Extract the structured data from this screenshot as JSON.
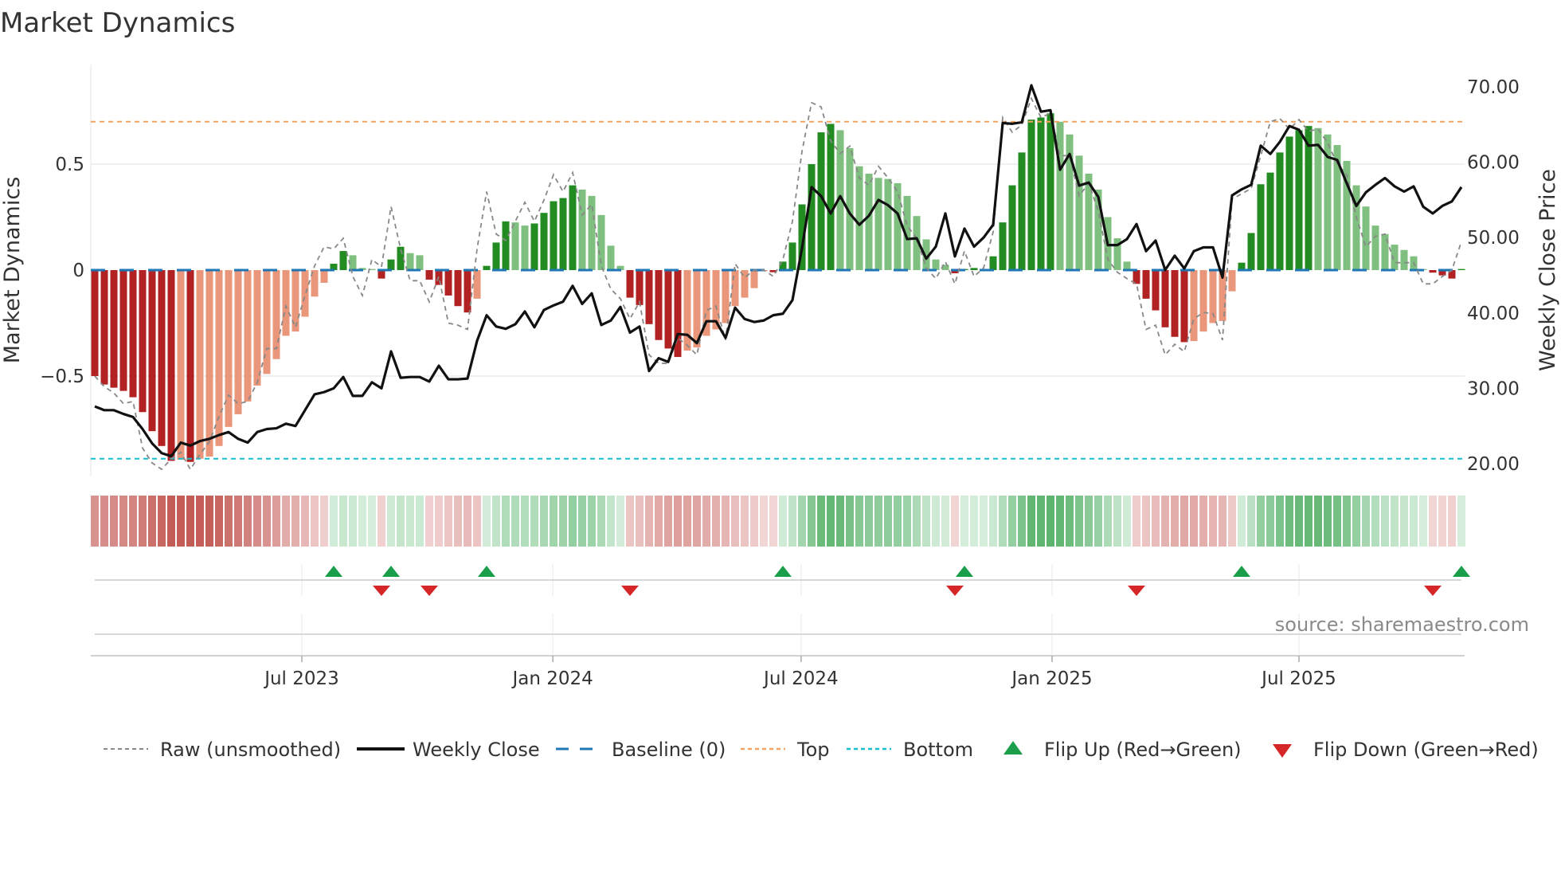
{
  "title": "Market Dynamics",
  "source": "source: sharemaestro.com",
  "legend": {
    "raw": "Raw (unsmoothed)",
    "close": "Weekly Close",
    "baseline": "Baseline (0)",
    "top": "Top",
    "bottom": "Bottom",
    "flip_up": "Flip Up (Red→Green)",
    "flip_down": "Flip Down (Green→Red)"
  },
  "colors": {
    "dark_red": "#b22222",
    "light_red": "#e9967a",
    "dark_green": "#228b22",
    "light_green": "#7fbf7f",
    "baseline": "#1f77b4",
    "top": "#f4a460",
    "bottom": "#17becf",
    "raw": "#888888",
    "close": "#111111",
    "flip_up": "#1a9e4a",
    "flip_down": "#d62728"
  },
  "chart_data": {
    "type": "bar",
    "title": "Market Dynamics",
    "ylabel": "Market Dynamics",
    "y2label": "Weekly Close Price",
    "ylim": [
      -0.91,
      0.91
    ],
    "y2lim": [
      20,
      70
    ],
    "grid": true,
    "legend_position": "bottom",
    "start_week": "2023-01-30",
    "frequency": "weekly",
    "top_level": 0.7,
    "bottom_level": -0.89,
    "baseline": 0,
    "yticks": [
      {
        "value": 0.5,
        "label": "0.5"
      },
      {
        "value": 0,
        "label": "0"
      },
      {
        "value": -0.5,
        "label": "−0.5"
      }
    ],
    "y2ticks": [
      {
        "value": 70,
        "label": "70.00"
      },
      {
        "value": 60,
        "label": "60.00"
      },
      {
        "value": 50,
        "label": "50.00"
      },
      {
        "value": 40,
        "label": "40.00"
      },
      {
        "value": 30,
        "label": "30.00"
      },
      {
        "value": 20,
        "label": "20.00"
      }
    ],
    "xticks": [
      {
        "date": "2023-07-01",
        "label": "Jul 2023"
      },
      {
        "date": "2024-01-01",
        "label": "Jan 2024"
      },
      {
        "date": "2024-07-01",
        "label": "Jul 2024"
      },
      {
        "date": "2025-01-01",
        "label": "Jan 2025"
      },
      {
        "date": "2025-07-01",
        "label": "Jul 2025"
      }
    ],
    "dynamics": [
      -0.5,
      -0.54,
      -0.555,
      -0.57,
      -0.6,
      -0.67,
      -0.76,
      -0.83,
      -0.9,
      -0.895,
      -0.905,
      -0.89,
      -0.88,
      -0.83,
      -0.74,
      -0.68,
      -0.62,
      -0.545,
      -0.49,
      -0.42,
      -0.31,
      -0.29,
      -0.22,
      -0.125,
      -0.06,
      0.03,
      0.09,
      0.07,
      0.01,
      0.005,
      -0.04,
      0.05,
      0.11,
      0.08,
      0.07,
      -0.045,
      -0.07,
      -0.12,
      -0.17,
      -0.2,
      -0.135,
      0.02,
      0.13,
      0.23,
      0.225,
      0.21,
      0.22,
      0.27,
      0.325,
      0.34,
      0.4,
      0.38,
      0.35,
      0.26,
      0.115,
      0.02,
      -0.13,
      -0.165,
      -0.255,
      -0.33,
      -0.37,
      -0.41,
      -0.38,
      -0.365,
      -0.31,
      -0.28,
      -0.25,
      -0.17,
      -0.13,
      -0.085,
      -0.005,
      -0.01,
      0.04,
      0.13,
      0.31,
      0.5,
      0.65,
      0.69,
      0.66,
      0.575,
      0.49,
      0.455,
      0.435,
      0.43,
      0.41,
      0.35,
      0.255,
      0.145,
      0.05,
      0.025,
      -0.015,
      0.005,
      0.01,
      0.005,
      0.065,
      0.225,
      0.4,
      0.555,
      0.71,
      0.72,
      0.74,
      0.7,
      0.64,
      0.54,
      0.455,
      0.38,
      0.25,
      0.15,
      0.04,
      -0.065,
      -0.135,
      -0.19,
      -0.27,
      -0.315,
      -0.34,
      -0.335,
      -0.29,
      -0.25,
      -0.24,
      -0.1,
      0.035,
      0.175,
      0.405,
      0.46,
      0.555,
      0.63,
      0.66,
      0.68,
      0.67,
      0.64,
      0.59,
      0.515,
      0.4,
      0.3,
      0.21,
      0.17,
      0.12,
      0.095,
      0.065,
      0.005,
      -0.012,
      -0.025,
      -0.04,
      0.005
    ],
    "raw": [
      -0.5,
      -0.55,
      -0.58,
      -0.63,
      -0.62,
      -0.84,
      -0.91,
      -0.94,
      -0.89,
      -0.86,
      -0.94,
      -0.87,
      -0.81,
      -0.69,
      -0.59,
      -0.63,
      -0.62,
      -0.53,
      -0.37,
      -0.37,
      -0.17,
      -0.27,
      -0.12,
      0.02,
      0.11,
      0.1,
      0.15,
      -0.03,
      -0.12,
      0.05,
      0.015,
      0.3,
      0.1,
      -0.05,
      -0.05,
      -0.15,
      -0.03,
      -0.25,
      -0.26,
      -0.28,
      0.1,
      0.37,
      0.17,
      0.14,
      0.23,
      0.32,
      0.23,
      0.33,
      0.45,
      0.37,
      0.46,
      0.26,
      0.31,
      0.02,
      -0.09,
      -0.135,
      -0.23,
      -0.15,
      -0.4,
      -0.44,
      -0.44,
      -0.32,
      -0.355,
      -0.4,
      -0.19,
      -0.17,
      -0.33,
      0.03,
      -0.035,
      0.0,
      0.0,
      -0.03,
      0.05,
      0.23,
      0.56,
      0.79,
      0.77,
      0.61,
      0.55,
      0.585,
      0.435,
      0.4,
      0.49,
      0.435,
      0.37,
      0.21,
      0.15,
      0.01,
      -0.04,
      0.04,
      -0.065,
      0.09,
      -0.03,
      0.01,
      0.18,
      0.72,
      0.65,
      0.685,
      0.81,
      0.72,
      0.74,
      0.54,
      0.54,
      0.35,
      0.41,
      0.28,
      0.05,
      -0.01,
      -0.04,
      -0.065,
      -0.28,
      -0.26,
      -0.4,
      -0.35,
      -0.385,
      -0.23,
      -0.2,
      -0.205,
      -0.33,
      0.335,
      0.36,
      0.385,
      0.54,
      0.7,
      0.715,
      0.665,
      0.71,
      0.655,
      0.665,
      0.6,
      0.5,
      0.45,
      0.25,
      0.11,
      0.16,
      0.17,
      0.035,
      0.035,
      0.035,
      -0.065,
      -0.065,
      -0.03,
      0.0,
      0.135
    ],
    "weekly_close": [
      27.6,
      27.1,
      27.1,
      26.6,
      26.2,
      24.6,
      22.7,
      21.4,
      21.0,
      22.8,
      22.4,
      23.0,
      23.3,
      23.8,
      24.2,
      23.3,
      22.8,
      24.2,
      24.6,
      24.7,
      25.3,
      25.0,
      27.1,
      29.2,
      29.5,
      30.0,
      31.5,
      29.0,
      29.0,
      30.8,
      30.0,
      34.9,
      31.4,
      31.5,
      31.5,
      30.9,
      33.0,
      31.2,
      31.2,
      31.3,
      36.3,
      39.7,
      38.2,
      37.9,
      38.5,
      40.2,
      38.1,
      40.4,
      41.0,
      41.5,
      43.6,
      41.2,
      42.6,
      38.4,
      39.0,
      40.8,
      37.4,
      38.2,
      32.3,
      34.0,
      33.5,
      37.2,
      37.1,
      36.0,
      38.9,
      38.9,
      36.7,
      40.7,
      39.2,
      38.8,
      39.0,
      39.7,
      39.9,
      41.7,
      48.6,
      56.7,
      55.5,
      53.2,
      55.5,
      53.2,
      51.7,
      52.9,
      55.0,
      54.3,
      53.2,
      49.8,
      49.9,
      47.2,
      48.8,
      53.2,
      47.5,
      51.2,
      48.8,
      50.0,
      51.7,
      65.2,
      65.1,
      65.3,
      70.2,
      66.7,
      66.9,
      59.0,
      61.1,
      56.9,
      57.3,
      55.4,
      49.0,
      49.0,
      49.8,
      51.8,
      48.2,
      49.6,
      45.7,
      47.6,
      45.9,
      48.2,
      48.7,
      48.7,
      44.7,
      55.6,
      56.4,
      57.0,
      62.2,
      61.1,
      62.7,
      64.8,
      64.3,
      62.2,
      62.3,
      60.7,
      60.3,
      57.2,
      54.2,
      56.0,
      57.0,
      57.9,
      56.8,
      56.1,
      56.8,
      54.1,
      53.2,
      54.2,
      54.8,
      56.7
    ],
    "flip_up_weeks": [
      26,
      32,
      42,
      73,
      92,
      121,
      144
    ],
    "flip_down_weeks": [
      31,
      36,
      57,
      91,
      110,
      141
    ]
  }
}
